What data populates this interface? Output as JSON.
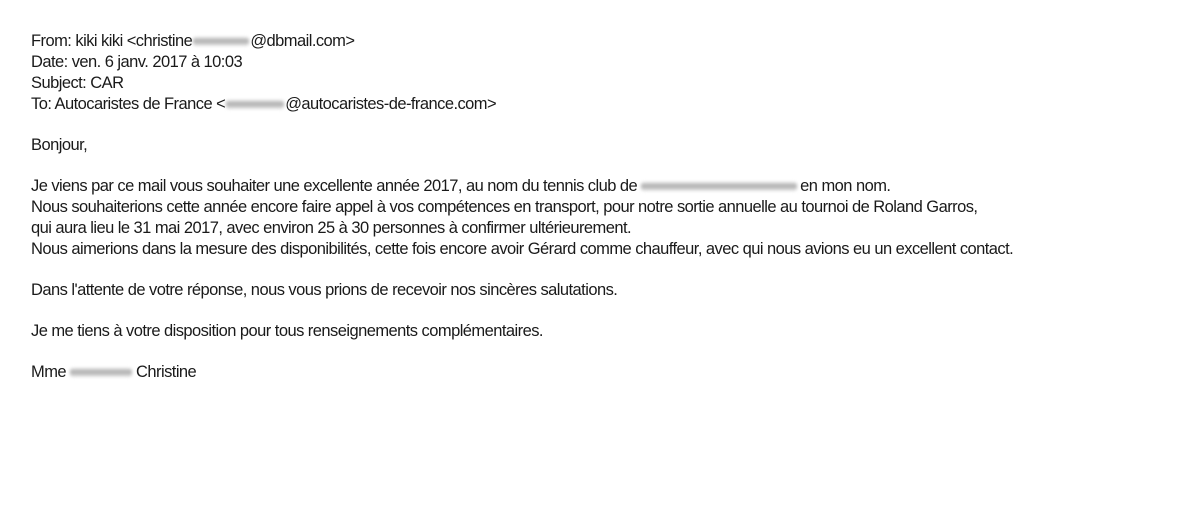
{
  "header": {
    "from_label": "From:",
    "from_name": "kiki kiki <christine",
    "from_domain": "@dbmail.com>",
    "date_label": "Date:",
    "date_value": "ven. 6 janv. 2017 à 10:03",
    "subject_label": "Subject:",
    "subject_value": "CAR",
    "to_label": "To:",
    "to_name": "Autocaristes de France <",
    "to_domain": "@autocaristes-de-france.com>"
  },
  "body": {
    "greeting": "Bonjour,",
    "p1_line1_start": "Je viens par ce mail vous souhaiter une excellente année 2017, au nom du tennis club de",
    "p1_line1_end": "en mon nom.",
    "p1_line2": "Nous souhaiterions cette année encore faire appel à vos compétences en transport, pour notre sortie annuelle au tournoi de Roland Garros,",
    "p1_line3": "qui aura lieu le 31 mai 2017, avec environ 25 à 30 personnes à confirmer ultérieurement.",
    "p1_line4": "Nous aimerions dans la mesure des disponibilités, cette fois encore avoir Gérard comme chauffeur, avec qui nous avions eu un excellent contact.",
    "closing1": "Dans l'attente de votre réponse, nous vous prions de recevoir nos sincères salutations.",
    "closing2": "Je me tiens à votre disposition pour tous renseignements complémentaires.",
    "signature_title": "Mme",
    "signature_name": "Christine"
  }
}
